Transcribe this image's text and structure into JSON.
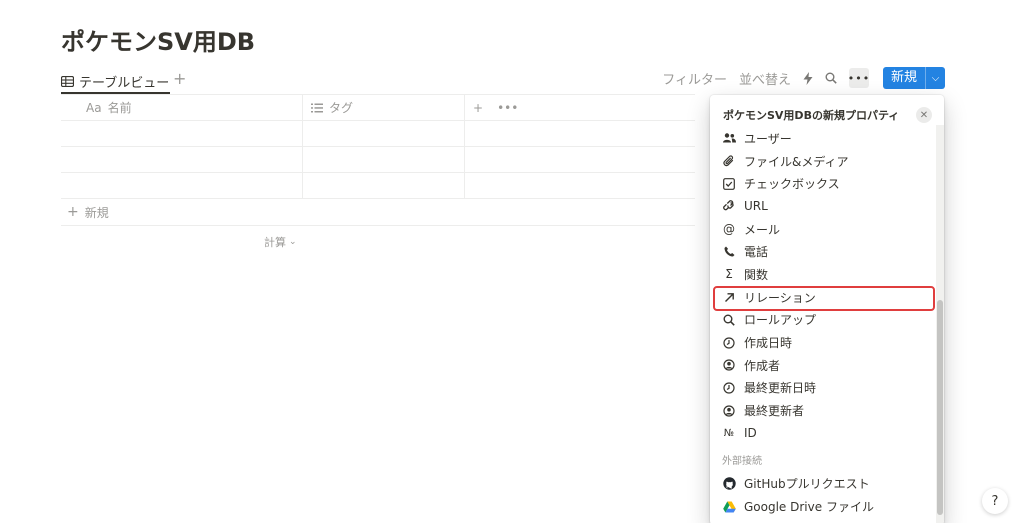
{
  "page": {
    "title": "ポケモンSV用DB"
  },
  "views": {
    "active_tab": "テーブルビュー",
    "add_symbol": "+"
  },
  "toolbar": {
    "filter": "フィルター",
    "sort": "並べ替え",
    "more": "•••",
    "new_label": "新規"
  },
  "table": {
    "columns": [
      {
        "icon": "Aa",
        "label": "名前"
      },
      {
        "icon": "list-icon",
        "label": "タグ"
      }
    ],
    "add_column": "+",
    "column_more": "•••",
    "rows": [
      "",
      "",
      ""
    ],
    "new_row_label": "新規",
    "calc_label": "計算"
  },
  "property_panel": {
    "title": "ポケモンSV用DBの新規プロパティ",
    "items": [
      {
        "icon": "people-icon",
        "label": "ユーザー"
      },
      {
        "icon": "paperclip-icon",
        "label": "ファイル&メディア"
      },
      {
        "icon": "checkbox-icon",
        "label": "チェックボックス"
      },
      {
        "icon": "link-icon",
        "label": "URL"
      },
      {
        "icon": "at-icon",
        "label": "メール"
      },
      {
        "icon": "phone-icon",
        "label": "電話"
      },
      {
        "icon": "sigma-icon",
        "label": "関数"
      },
      {
        "icon": "arrow-up-right-icon",
        "label": "リレーション",
        "selected": true
      },
      {
        "icon": "search-icon",
        "label": "ロールアップ"
      },
      {
        "icon": "clock-icon",
        "label": "作成日時"
      },
      {
        "icon": "user-circle-icon",
        "label": "作成者"
      },
      {
        "icon": "clock-icon",
        "label": "最終更新日時"
      },
      {
        "icon": "user-circle-icon",
        "label": "最終更新者"
      },
      {
        "icon": "numero-icon",
        "label": "ID"
      }
    ],
    "external_section": "外部接続",
    "external_items": [
      {
        "icon": "github-icon",
        "label": "GitHubプルリクエスト"
      },
      {
        "icon": "google-drive-icon",
        "label": "Google Drive ファイル"
      }
    ]
  },
  "help": {
    "label": "?"
  },
  "colors": {
    "accent": "#2383e2",
    "highlight": "#e03e3e",
    "text": "#37352f",
    "muted": "#9b9a97"
  }
}
